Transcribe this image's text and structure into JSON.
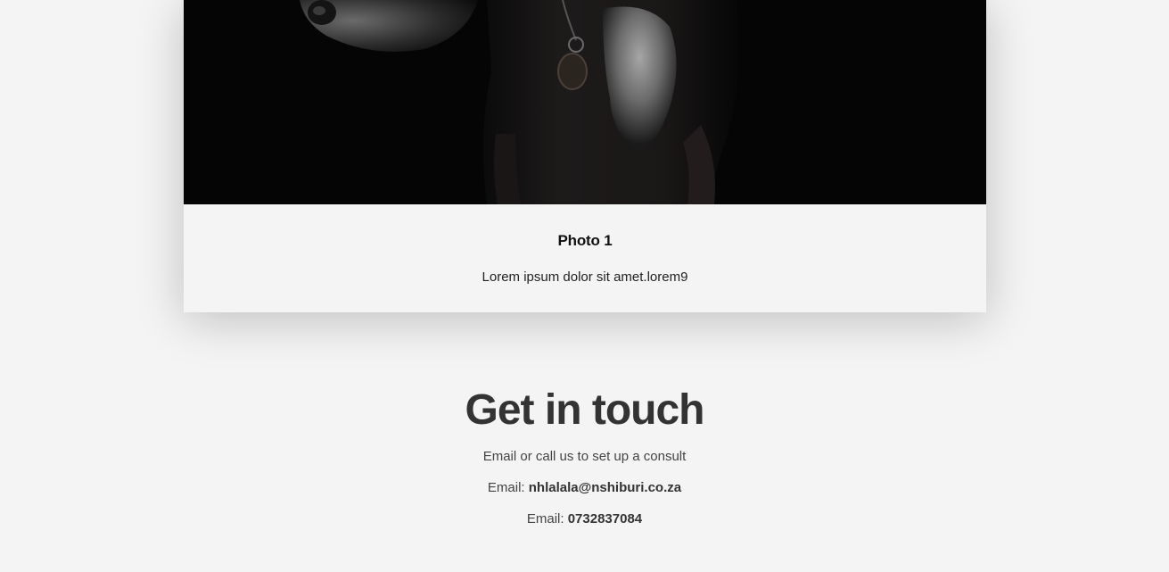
{
  "gallery_card": {
    "photo_alt": "Dark portrait of a dog",
    "title": "Photo 1",
    "description": "Lorem ipsum dolor sit amet.lorem9"
  },
  "contact": {
    "heading": "Get in touch",
    "subtitle": "Email or call us to set up a consult",
    "email_label": "Email:",
    "email_value": "nhlalala@nshiburi.co.za",
    "phone_label": "Email:",
    "phone_value": "0732837084"
  },
  "colors": {
    "page_background": "#f4f4f4",
    "photo_background": "#050505",
    "heading_text": "#333333"
  }
}
